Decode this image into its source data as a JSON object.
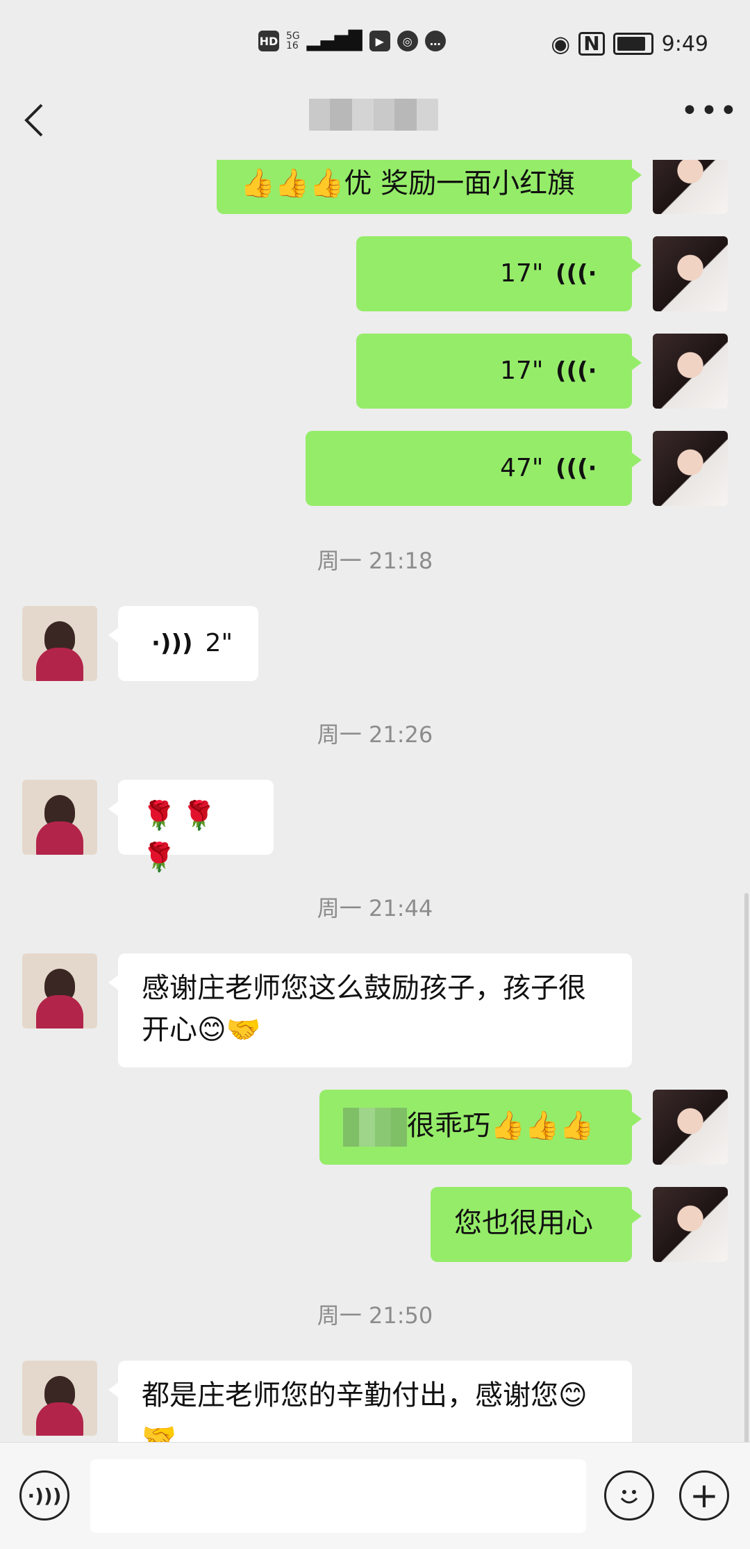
{
  "status_bar": {
    "hd": "HD",
    "network": "5G",
    "signal_sub": "16",
    "time": "9:49"
  },
  "header": {
    "back_icon": "chevron-left-icon",
    "more_icon": "more-icon"
  },
  "messages": [
    {
      "side": "me",
      "type": "text",
      "text": "👍👍👍优 奖励一面小红旗"
    },
    {
      "side": "me",
      "type": "voice",
      "duration": "17\""
    },
    {
      "side": "me",
      "type": "voice",
      "duration": "17\""
    },
    {
      "side": "me",
      "type": "voice",
      "duration": "47\""
    },
    {
      "type": "time",
      "text": "周一 21:18"
    },
    {
      "side": "other",
      "type": "voice",
      "duration": "2\""
    },
    {
      "type": "time",
      "text": "周一 21:26"
    },
    {
      "side": "other",
      "type": "text",
      "text": "🌹🌹🌹"
    },
    {
      "type": "time",
      "text": "周一 21:44"
    },
    {
      "side": "other",
      "type": "text",
      "text": "感谢庄老师您这么鼓励孩子，孩子很开心😊🤝"
    },
    {
      "side": "me",
      "type": "text",
      "text": "很乖巧👍👍👍"
    },
    {
      "side": "me",
      "type": "text",
      "text": "您也很用心"
    },
    {
      "type": "time",
      "text": "周一 21:50"
    },
    {
      "side": "other",
      "type": "text",
      "text": "都是庄老师您的辛勤付出，感谢您😊🤝"
    }
  ],
  "input_bar": {
    "voice_icon": "voice-input-icon",
    "emoji_icon": "emoji-icon",
    "plus_icon": "plus-icon",
    "placeholder": ""
  },
  "colors": {
    "my_bubble": "#95ec69",
    "other_bubble": "#ffffff",
    "background": "#ededed"
  }
}
